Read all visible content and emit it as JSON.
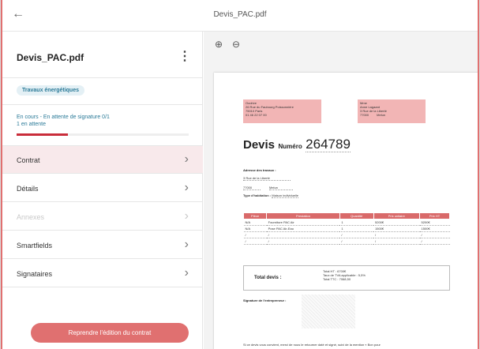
{
  "app": {
    "title": "Devis_PAC.pdf",
    "back_icon": "arrow-left-icon"
  },
  "sidebar": {
    "doc_title": "Devis_PAC.pdf",
    "badge": "Travaux énergétiques",
    "status_line1": "En cours - En attente de signature 0/1",
    "status_line2": "1 en attente",
    "progress": 0.3,
    "items": [
      {
        "label": "Contrat",
        "active": true,
        "disabled": false
      },
      {
        "label": "Détails",
        "active": false,
        "disabled": false
      },
      {
        "label": "Annexes",
        "active": false,
        "disabled": true
      },
      {
        "label": "Smartfields",
        "active": false,
        "disabled": false
      },
      {
        "label": "Signataires",
        "active": false,
        "disabled": false
      }
    ],
    "resume_button": "Reprendre l'édition du contrat"
  },
  "colors": {
    "accent": "#e07070",
    "brand_red": "#c92d3a",
    "teal": "#2a7a98",
    "pink_field": "#f2b5b5"
  },
  "pdf": {
    "company": [
      "Oodrive",
      "26 Rue du Faubourg Poissonnière",
      "75010 Paris",
      "01 46 22 07 00"
    ],
    "client": [
      "Mme",
      "Anne Lagaard",
      "3 Rue de la Liberté",
      "77000",
      "Melun"
    ],
    "devis_label": "Devis",
    "numero_label": "Numéro",
    "numero": "264789",
    "adresse_label": "Adresse des travaux :",
    "adresse_line": "3 Rue de la Liberté",
    "adresse_cp": "77000",
    "adresse_ville": "Melun",
    "habitation_label": "Type d'habitation :",
    "habitation_value": "Maison individuelle",
    "table_headers": [
      "Pièce",
      "Prestation",
      "Quantité",
      "Prix unitaire",
      "Prix HT"
    ],
    "table_rows": [
      [
        "N/A",
        "Fourniture PAC Air",
        "1",
        "5200€",
        "5200€"
      ],
      [
        "N/A",
        "Pose PAC Air-Eau",
        "1",
        "1500€",
        "1500€"
      ],
      [
        "/",
        "/",
        "/",
        "/",
        "/"
      ],
      [
        "/",
        "/",
        "/",
        "/",
        "/"
      ]
    ],
    "total_label": "Total devis :",
    "total_ht": "Total HT : 6700€",
    "tva": "Taux de TVA applicable : 5,5%",
    "total_ttc": "Total TTC : 7068,50",
    "signature_label": "Signature de l'entrepreneur :",
    "footer": "Si ce devis vous convient, merci de nous le retourner daté et signé, suivi de la mention « Bon pour"
  },
  "viewer": {
    "zoom_in_icon": "zoom-in-icon",
    "zoom_out_icon": "zoom-out-icon"
  }
}
